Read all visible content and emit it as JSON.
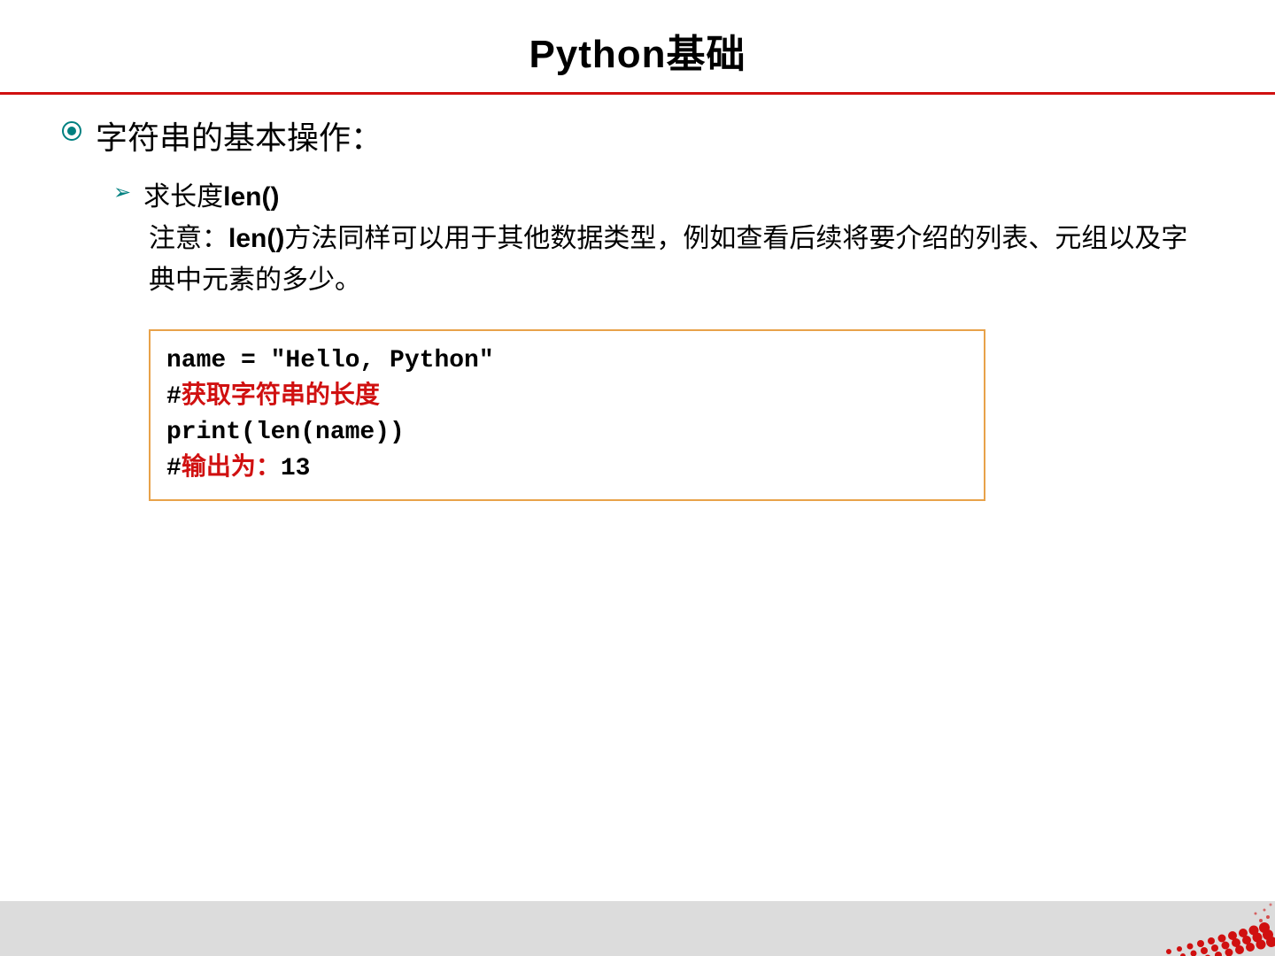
{
  "title": "Python基础",
  "main_bullet": "字符串的基本操作：",
  "sub_bullet": {
    "prefix": "求长度",
    "bold": "len()"
  },
  "note": {
    "prefix": "注意：",
    "bold": "len()",
    "rest": "方法同样可以用于其他数据类型，例如查看后续将要介绍的列表、元组以及字典中元素的多少。"
  },
  "code": {
    "line1": "name = \"Hello, Python\"",
    "line2_hash": "#",
    "line2_red": "获取字符串的长度",
    "line3": "print(len(name))",
    "line4_hash": "#",
    "line4_red": "输出为：",
    "line4_black": "13"
  }
}
